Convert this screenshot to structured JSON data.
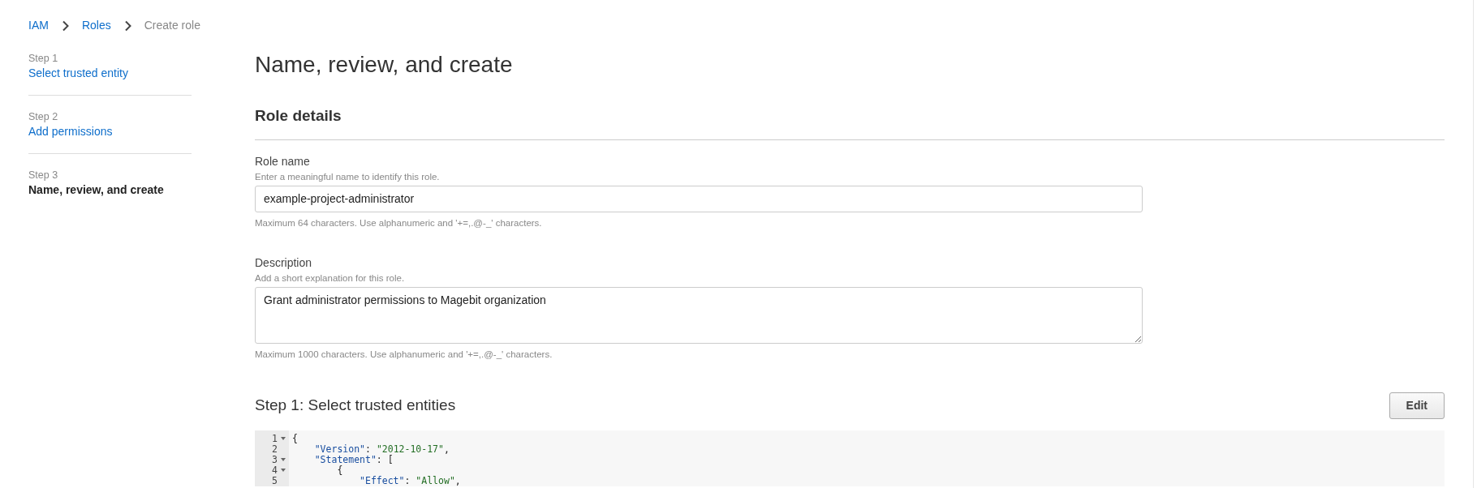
{
  "breadcrumb": [
    {
      "label": "IAM",
      "current": false
    },
    {
      "label": "Roles",
      "current": false
    },
    {
      "label": "Create role",
      "current": true
    }
  ],
  "steps": [
    {
      "step": "Step 1",
      "title": "Select trusted entity",
      "current": false
    },
    {
      "step": "Step 2",
      "title": "Add permissions",
      "current": false
    },
    {
      "step": "Step 3",
      "title": "Name, review, and create",
      "current": true
    }
  ],
  "page_title": "Name, review, and create",
  "section_title": "Role details",
  "fields": [
    {
      "kind": "input",
      "label": "Role name",
      "hint": "Enter a meaningful name to identify this role.",
      "value": "example-project-administrator",
      "constraint": "Maximum 64 characters. Use alphanumeric and '+=,.@-_' characters."
    },
    {
      "kind": "textarea",
      "label": "Description",
      "hint": "Add a short explanation for this role.",
      "value": "Grant administrator permissions to Magebit organization",
      "constraint": "Maximum 1000 characters. Use alphanumeric and '+=,.@-_' characters."
    }
  ],
  "trusted_entities": {
    "title": "Step 1: Select trusted entities",
    "button": "Edit",
    "code_lines": [
      {
        "number": "1",
        "foldable": true,
        "tokens": [
          {
            "kind": "punct",
            "text": "{"
          }
        ]
      },
      {
        "number": "2",
        "foldable": false,
        "tokens": [
          {
            "kind": "key",
            "text": "    \"Version\""
          },
          {
            "kind": "punct",
            "text": ": "
          },
          {
            "kind": "string",
            "text": "\"2012-10-17\""
          },
          {
            "kind": "punct",
            "text": ","
          }
        ]
      },
      {
        "number": "3",
        "foldable": true,
        "tokens": [
          {
            "kind": "key",
            "text": "    \"Statement\""
          },
          {
            "kind": "punct",
            "text": ": ["
          }
        ]
      },
      {
        "number": "4",
        "foldable": true,
        "tokens": [
          {
            "kind": "punct",
            "text": "        {"
          }
        ]
      },
      {
        "number": "5",
        "foldable": false,
        "tokens": [
          {
            "kind": "key",
            "text": "            \"Effect\""
          },
          {
            "kind": "punct",
            "text": ": "
          },
          {
            "kind": "string",
            "text": "\"Allow\""
          },
          {
            "kind": "punct",
            "text": ","
          }
        ]
      }
    ]
  }
}
